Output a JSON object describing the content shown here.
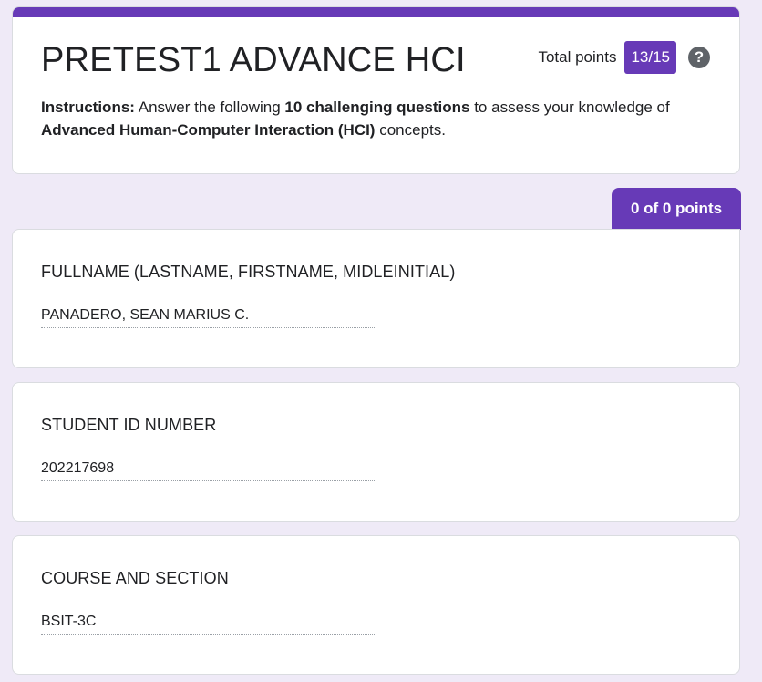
{
  "form": {
    "title": "PRETEST1 ADVANCE HCI",
    "total_points_label": "Total points",
    "total_points_value": "13/15",
    "help_icon": "question-mark-icon",
    "instructions": {
      "prefix": "Instructions:",
      "part1": " Answer the following ",
      "bold1": "10 challenging questions",
      "part2": " to assess your knowledge of ",
      "bold2": "Advanced Human-Computer Interaction (HCI)",
      "part3": " concepts."
    }
  },
  "section_score": "0 of 0 points",
  "questions": [
    {
      "title": "FULLNAME (LASTNAME, FIRSTNAME, MIDLEINITIAL)",
      "answer": "PANADERO, SEAN MARIUS C."
    },
    {
      "title": "STUDENT ID NUMBER",
      "answer": "202217698"
    },
    {
      "title": "COURSE AND SECTION",
      "answer": "BSIT-3C"
    }
  ],
  "colors": {
    "accent": "#673ab7",
    "background": "#efeaf7",
    "card": "#ffffff"
  }
}
